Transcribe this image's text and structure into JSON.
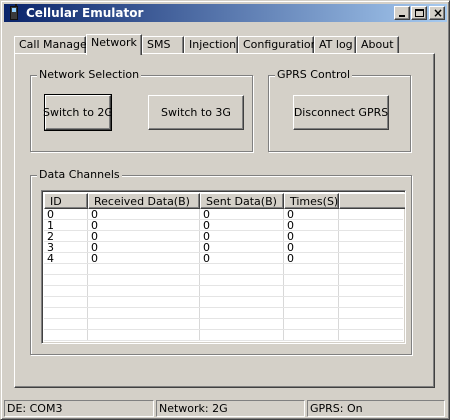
{
  "window": {
    "title": "Cellular Emulator",
    "controls": [
      "minimize",
      "maximize",
      "close"
    ]
  },
  "tabs": [
    {
      "label": "Call Manager",
      "active": false
    },
    {
      "label": "Network",
      "active": true
    },
    {
      "label": "SMS",
      "active": false
    },
    {
      "label": "Injection",
      "active": false
    },
    {
      "label": "Configuration",
      "active": false
    },
    {
      "label": "AT log",
      "active": false
    },
    {
      "label": "About",
      "active": false
    }
  ],
  "network_selection": {
    "title": "Network Selection",
    "switch_2g_label": "Switch to 2G",
    "switch_3g_label": "Switch to 3G"
  },
  "gprs_control": {
    "title": "GPRS Control",
    "disconnect_label": "Disconnect GPRS"
  },
  "data_channels": {
    "title": "Data Channels",
    "columns": [
      "ID",
      "Received Data(B)",
      "Sent Data(B)",
      "Times(S)"
    ],
    "rows": [
      [
        "0",
        "0",
        "0",
        "0"
      ],
      [
        "1",
        "0",
        "0",
        "0"
      ],
      [
        "2",
        "0",
        "0",
        "0"
      ],
      [
        "3",
        "0",
        "0",
        "0"
      ],
      [
        "4",
        "0",
        "0",
        "0"
      ]
    ]
  },
  "statusbar": {
    "port": "DE: COM3",
    "network": "Network: 2G",
    "gprs": "GPRS: On"
  }
}
